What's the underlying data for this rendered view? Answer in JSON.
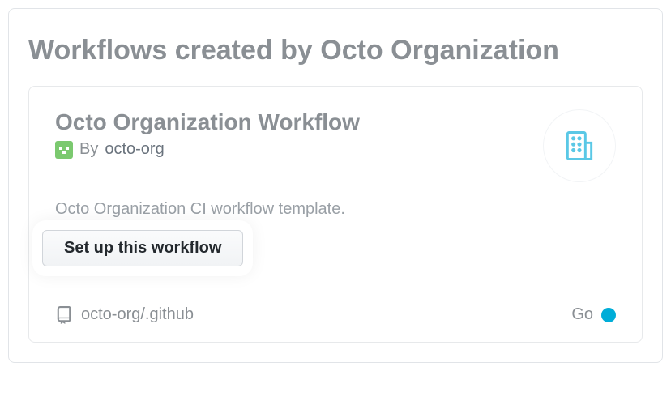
{
  "section": {
    "title": "Workflows created by Octo Organization"
  },
  "card": {
    "title": "Octo Organization Workflow",
    "by_prefix": "By ",
    "owner": "octo-org",
    "description": "Octo Organization CI workflow template.",
    "setup_button": "Set up this workflow",
    "repo_path": "octo-org/.github",
    "language": "Go",
    "language_color": "#00ADD8",
    "category_icon": "organization-icon"
  }
}
